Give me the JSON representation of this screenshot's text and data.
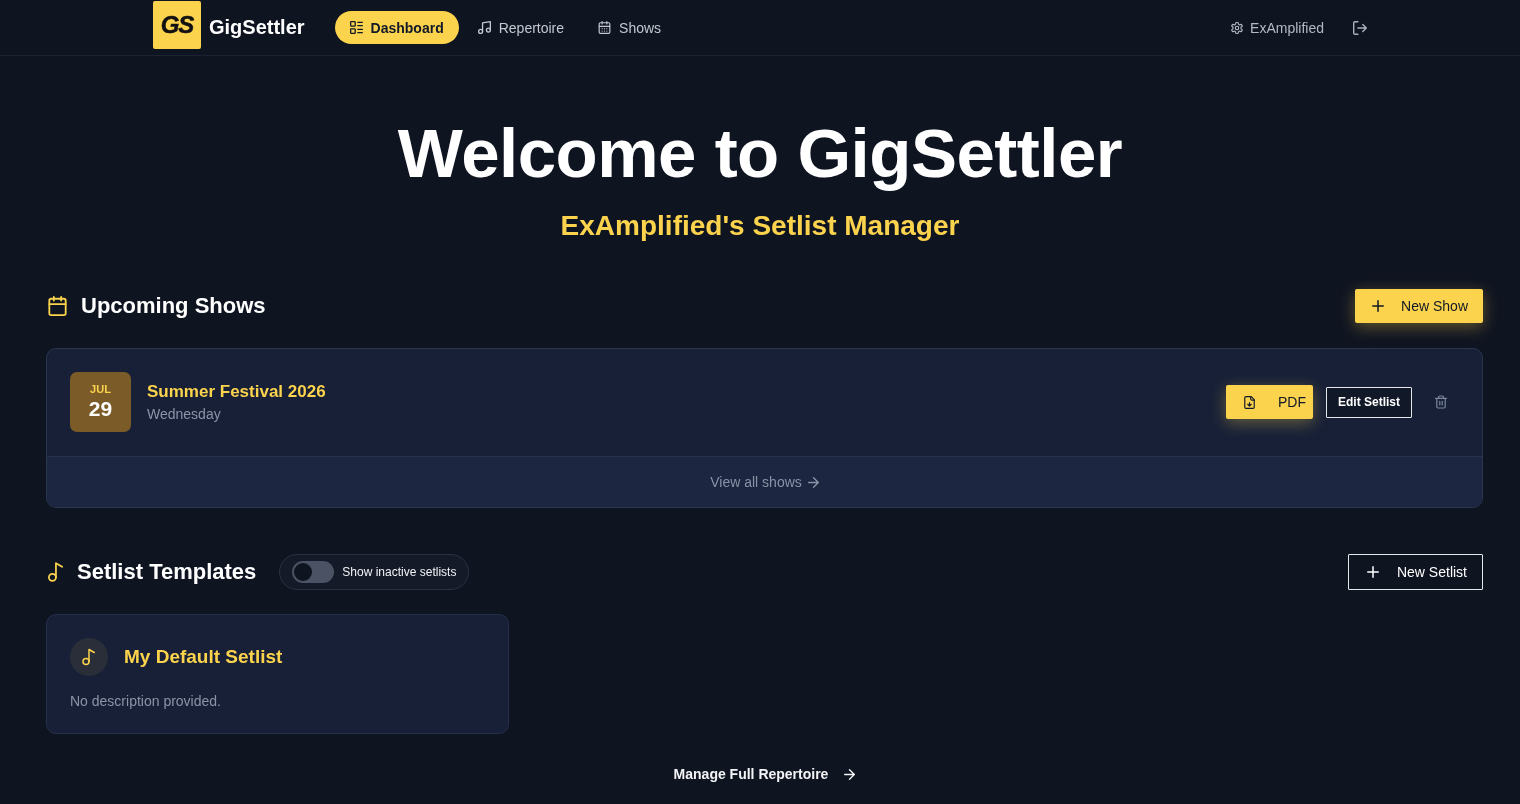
{
  "header": {
    "logo_text": "GS",
    "brand": "GigSettler",
    "nav": [
      {
        "label": "Dashboard",
        "selected": true
      },
      {
        "label": "Repertoire",
        "selected": false
      },
      {
        "label": "Shows",
        "selected": false
      }
    ],
    "user": "ExAmplified"
  },
  "hero": {
    "title": "Welcome to GigSettler",
    "subtitle": "ExAmplified's Setlist Manager"
  },
  "upcoming_shows": {
    "title": "Upcoming Shows",
    "new_button": "New Show",
    "shows": [
      {
        "month": "JUL",
        "day": "29",
        "name": "Summer Festival 2026",
        "weekday": "Wednesday",
        "pdf_button": "PDF",
        "edit_button": "Edit Setlist"
      }
    ],
    "view_all": "View all shows"
  },
  "setlist_templates": {
    "title": "Setlist Templates",
    "toggle": {
      "label": "Show inactive setlists",
      "on": false
    },
    "new_button": "New Setlist",
    "templates": [
      {
        "name": "My Default Setlist",
        "description": "No description provided."
      }
    ]
  },
  "footer_link": "Manage Full Repertoire"
}
